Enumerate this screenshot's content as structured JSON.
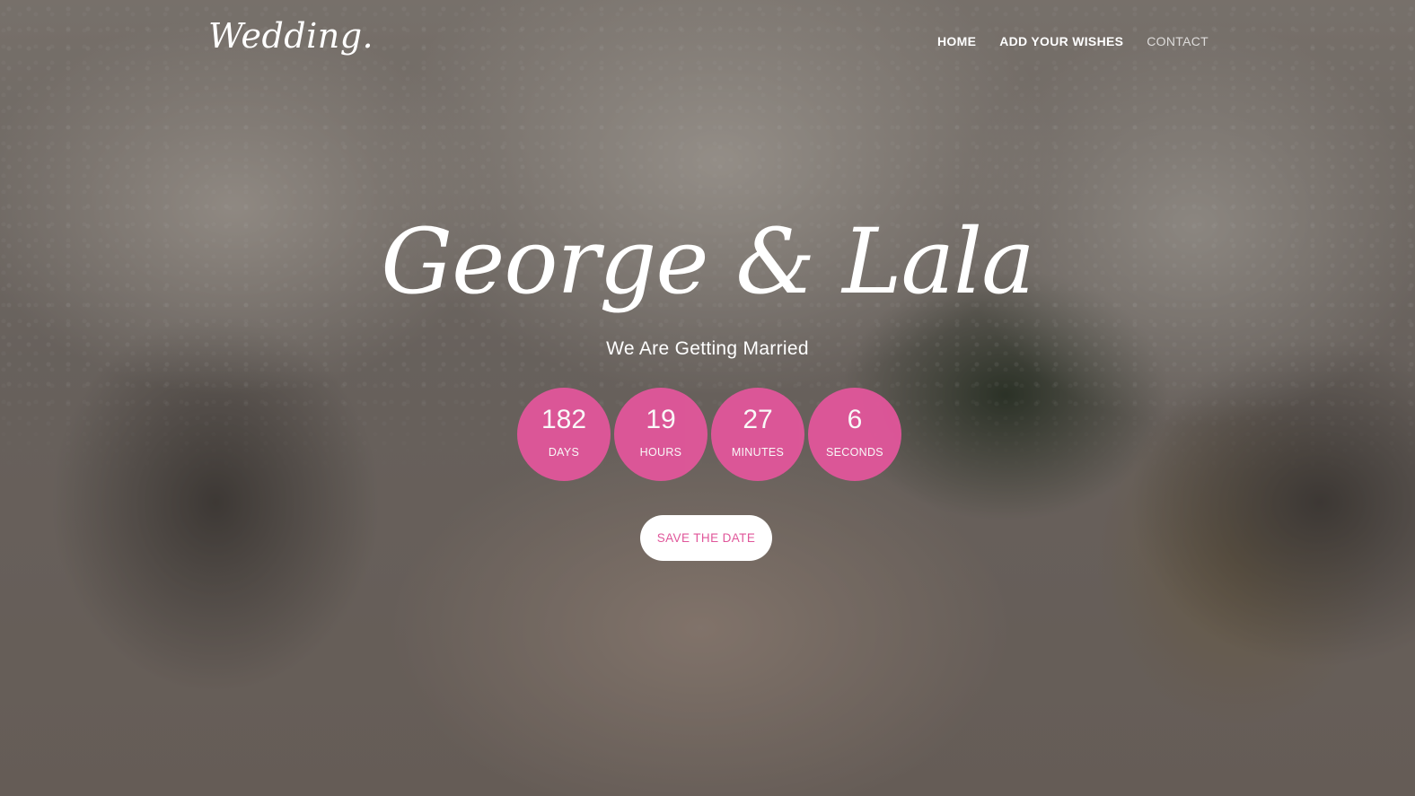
{
  "header": {
    "logo": "Wedding.",
    "nav": [
      {
        "label": "HOME"
      },
      {
        "label": "ADD YOUR WISHES"
      },
      {
        "label": "CONTACT"
      }
    ]
  },
  "hero": {
    "names": "George & Lala",
    "subtitle": "We Are Getting Married",
    "countdown": [
      {
        "value": "182",
        "label": "DAYS"
      },
      {
        "value": "19",
        "label": "HOURS"
      },
      {
        "value": "27",
        "label": "MINUTES"
      },
      {
        "value": "6",
        "label": "SECONDS"
      }
    ],
    "cta_label": "SAVE THE DATE"
  },
  "colors": {
    "accent": "#e0569a",
    "text": "#ffffff"
  }
}
